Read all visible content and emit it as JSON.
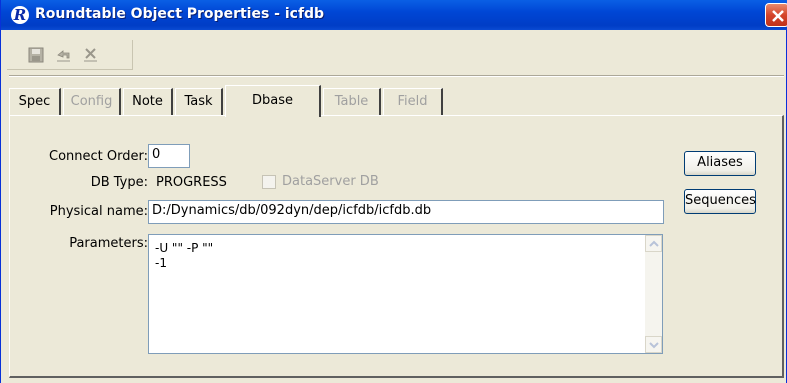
{
  "window": {
    "title": "Roundtable Object Properties - icfdb",
    "logo_letter": "R"
  },
  "toolbar": {
    "icons": [
      "save-icon",
      "undo-icon",
      "delete-icon"
    ]
  },
  "tabs": [
    {
      "label": "Spec",
      "enabled": true
    },
    {
      "label": "Config",
      "enabled": false
    },
    {
      "label": "Note",
      "enabled": true
    },
    {
      "label": "Task",
      "enabled": true
    },
    {
      "label": "Dbase",
      "enabled": true,
      "active": true
    },
    {
      "label": "Table",
      "enabled": false
    },
    {
      "label": "Field",
      "enabled": false
    }
  ],
  "form": {
    "connect_order_label": "Connect Order:",
    "connect_order_value": "0",
    "db_type_label": "DB Type:",
    "db_type_value": "PROGRESS",
    "dataserver_label": "DataServer DB",
    "dataserver_checked": false,
    "physical_name_label": "Physical name:",
    "physical_name_value": "D:/Dynamics/db/092dyn/dep/icfdb/icfdb.db",
    "parameters_label": "Parameters:",
    "parameters_lines": [
      "-U \"\" -P \"\"",
      "-1"
    ]
  },
  "buttons": {
    "aliases": "Aliases",
    "sequences": "Sequences"
  },
  "colors": {
    "titlebar": "#0046d5",
    "window_bg": "#ece9d8",
    "close_button": "#d5452b"
  }
}
